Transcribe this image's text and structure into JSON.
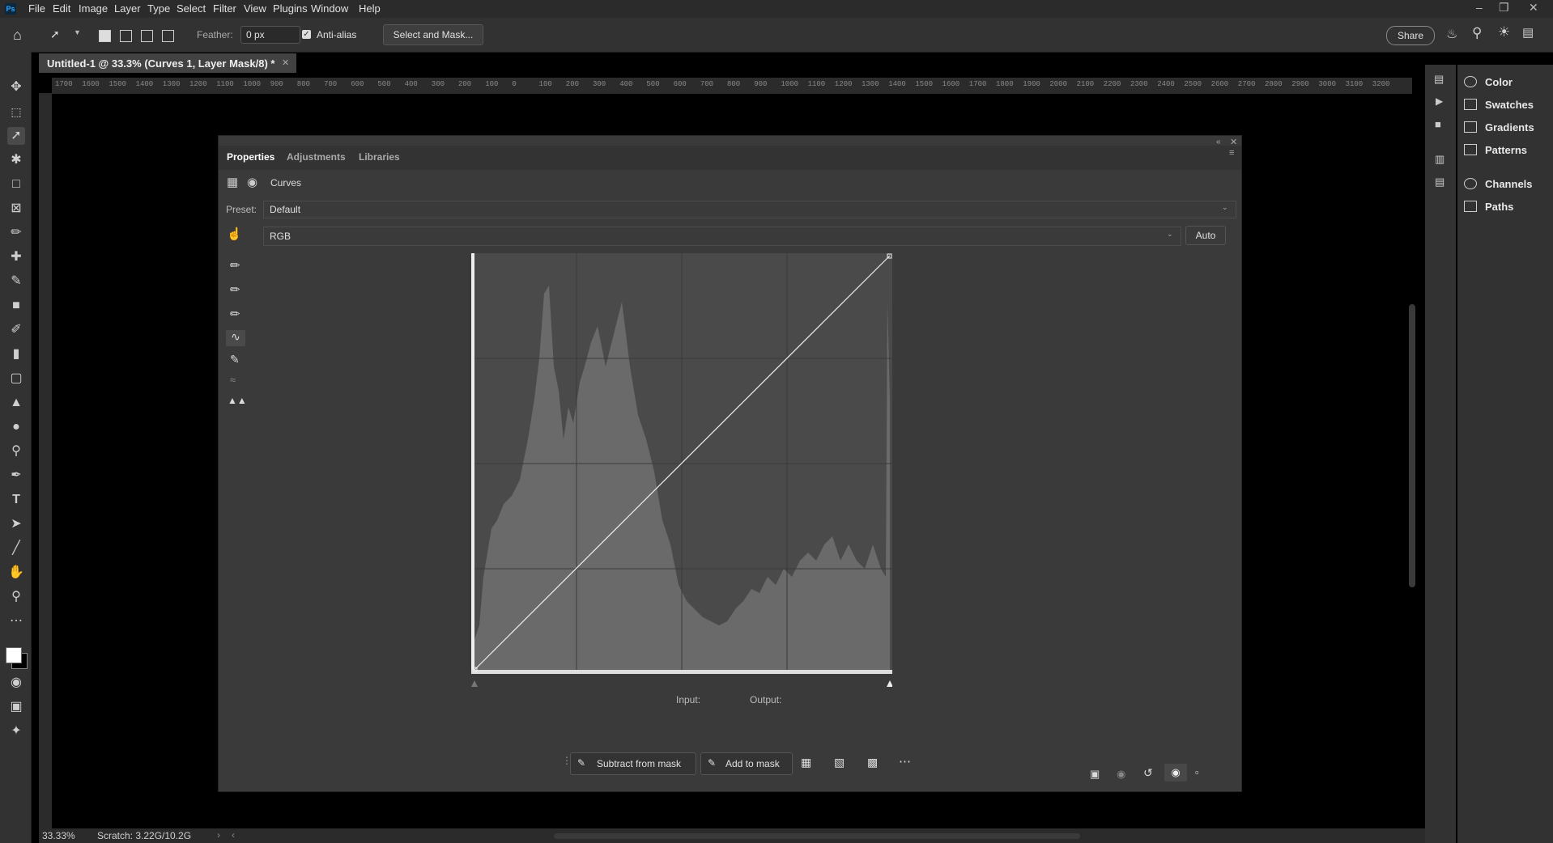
{
  "app": {
    "logo": "Ps"
  },
  "menu": [
    "File",
    "Edit",
    "Image",
    "Layer",
    "Type",
    "Select",
    "Filter",
    "View",
    "Plugins",
    "Window",
    "Help"
  ],
  "options": {
    "feather_label": "Feather:",
    "feather_value": "0 px",
    "antialias_label": "Anti-alias",
    "select_mask_label": "Select and Mask...",
    "share_label": "Share"
  },
  "document": {
    "tab_title": "Untitled-1 @ 33.3% (Curves 1, Layer Mask/8) *"
  },
  "ruler_labels": [
    "1700",
    "1600",
    "1500",
    "1400",
    "1300",
    "1200",
    "1100",
    "1000",
    "900",
    "800",
    "700",
    "600",
    "500",
    "400",
    "300",
    "200",
    "100",
    "0",
    "100",
    "200",
    "300",
    "400",
    "500",
    "600",
    "700",
    "800",
    "900",
    "1000",
    "1100",
    "1200",
    "1300",
    "1400",
    "1500",
    "1600",
    "1700",
    "1800",
    "1900",
    "2000",
    "2100",
    "2200",
    "2300",
    "2400",
    "2500",
    "2600",
    "2700",
    "2800",
    "2900",
    "3000",
    "3100",
    "3200"
  ],
  "properties": {
    "tabs": [
      "Properties",
      "Adjustments",
      "Libraries"
    ],
    "title": "Curves",
    "preset_label": "Preset:",
    "preset_value": "Default",
    "channel_value": "RGB",
    "auto_label": "Auto",
    "input_label": "Input:",
    "output_label": "Output:",
    "subtract_label": "Subtract from mask",
    "add_label": "Add to mask"
  },
  "right_panels": [
    "Color",
    "Swatches",
    "Gradients",
    "Patterns",
    "Channels",
    "Paths"
  ],
  "status": {
    "zoom": "33.33%",
    "scratch": "Scratch: 3.22G/10.2G"
  },
  "colors": {
    "accent": "#31a8ff",
    "panel": "#3a3a3a",
    "curve_bg": "#4a4a4a",
    "histogram": "#6a6a6a"
  }
}
